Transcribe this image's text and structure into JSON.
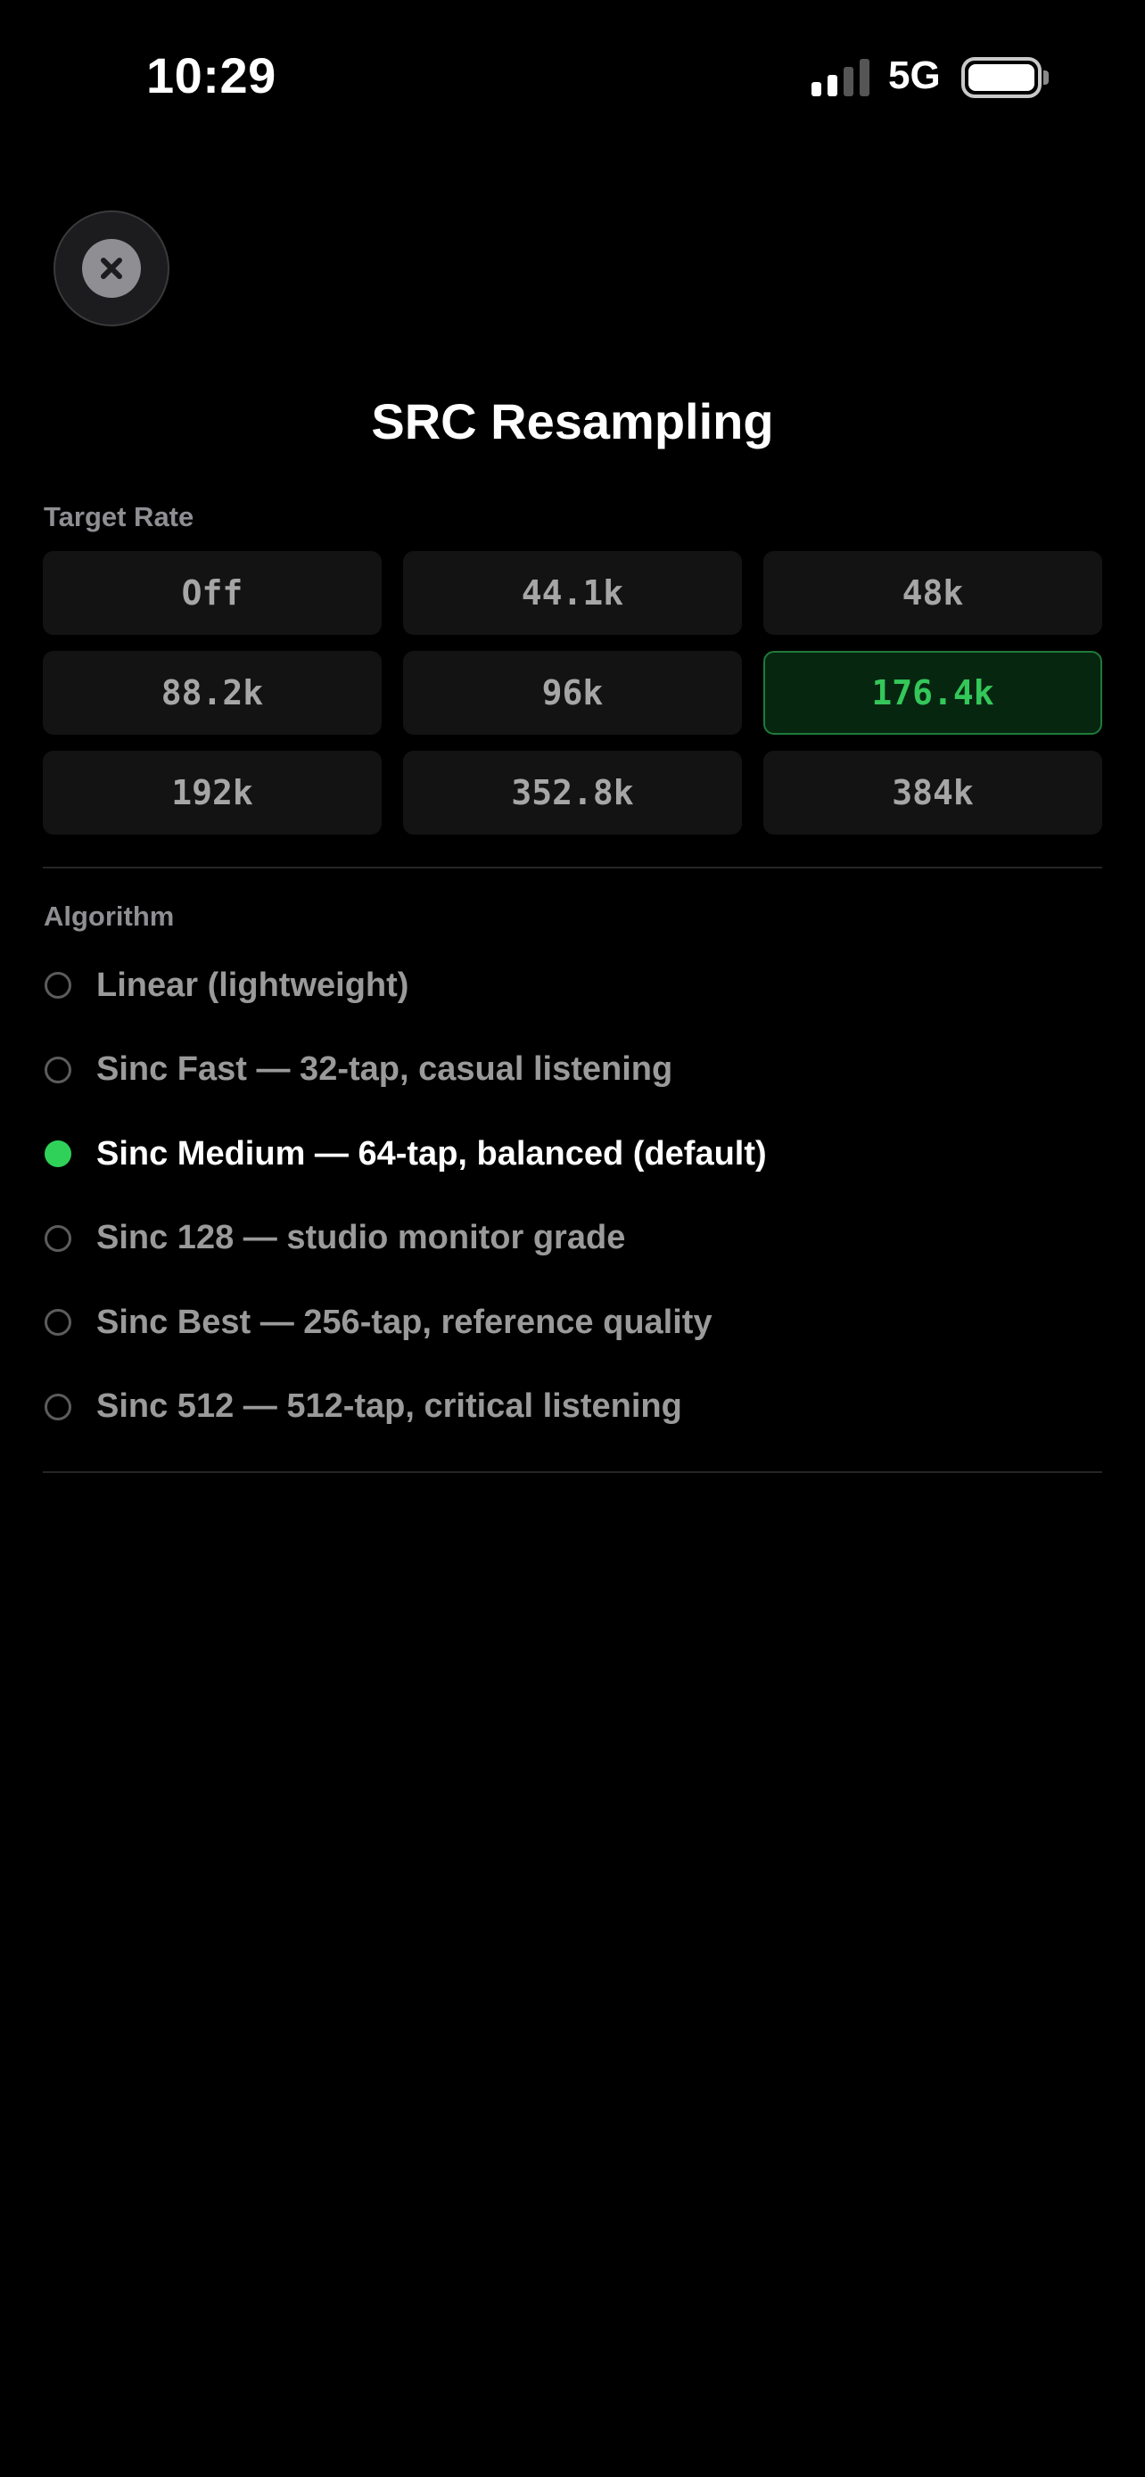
{
  "status_bar": {
    "time": "10:29",
    "network": "5G",
    "icons": [
      "cellular-signal-icon",
      "battery-icon"
    ]
  },
  "header": {
    "close_icon": "close-x-icon",
    "title": "SRC Resampling"
  },
  "target_rate": {
    "label": "Target Rate",
    "options": [
      "Off",
      "44.1k",
      "48k",
      "88.2k",
      "96k",
      "176.4k",
      "192k",
      "352.8k",
      "384k"
    ],
    "selected": "176.4k"
  },
  "algorithm": {
    "label": "Algorithm",
    "options": [
      "Linear (lightweight)",
      "Sinc Fast — 32-tap, casual listening",
      "Sinc Medium — 64-tap, balanced (default)",
      "Sinc 128 — studio monitor grade",
      "Sinc Best — 256-tap, reference quality",
      "Sinc 512 — 512-tap, critical listening"
    ],
    "selected": "Sinc Medium — 64-tap, balanced (default)"
  },
  "colors": {
    "background": "#000000",
    "accent_green": "#34c759",
    "radio_selected": "#30d158",
    "button_bg": "#131313",
    "selected_button_bg": "#062610",
    "selected_button_border": "#1f7a3a",
    "muted_text": "#8e8e93"
  }
}
